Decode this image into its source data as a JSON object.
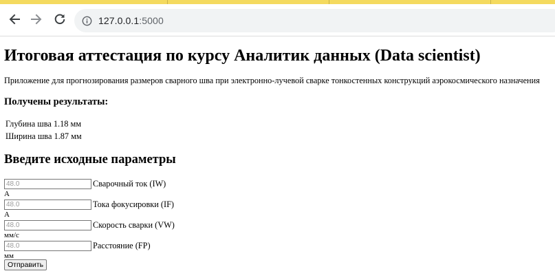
{
  "browser": {
    "url_host": "127.0.0.1",
    "url_port": ":5000"
  },
  "page": {
    "title": "Итоговая аттестация по курсу Аналитик данных (Data scientist)",
    "subtitle": "Приложение для прогнозирования размеров сварного шва при электронно-лучевой сварке тонкостенных конструкций аэрокосмического назначения",
    "results_heading": "Получены результаты:",
    "results": [
      "Глубина шва 1.18 мм",
      "Ширина шва 1.87 мм"
    ],
    "params_heading": "Введите исходные параметры",
    "fields": [
      {
        "placeholder": "48.0",
        "label": "Сварочный ток (IW)",
        "unit": "А"
      },
      {
        "placeholder": "48.0",
        "label": "Тока фокусировки (IF)",
        "unit": "А"
      },
      {
        "placeholder": "48.0",
        "label": "Скорость сварки (VW)",
        "unit": "мм/с"
      },
      {
        "placeholder": "48.0",
        "label": "Расстояние (FP)",
        "unit": "мм"
      }
    ],
    "submit_label": "Отправить"
  },
  "colors": {
    "top_strip": "#f4da5f",
    "omnibox_bg": "#f1f3f4"
  }
}
